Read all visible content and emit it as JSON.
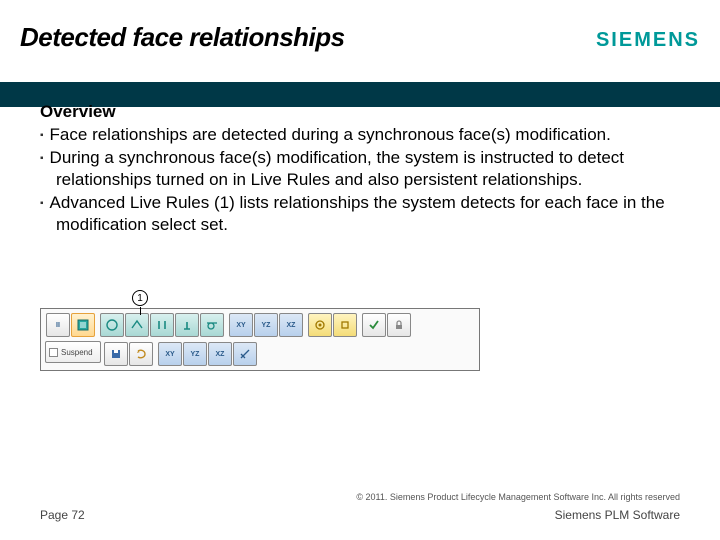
{
  "header": {
    "title": "Detected face relationships",
    "logo": "SIEMENS"
  },
  "content": {
    "overview_label": "Overview",
    "bullets": [
      "Face relationships are detected during a synchronous face(s) modification.",
      "During a synchronous face(s) modification, the system is instructed to detect relationships turned on in Live Rules and also persistent relationships.",
      "Advanced Live Rules (1) lists relationships the system detects for each face in the modification select set."
    ]
  },
  "toolbar": {
    "callout": "1",
    "suspend_label": "Suspend",
    "row1_icons": [
      "pause",
      "advanced",
      "symmetry",
      "coplanar",
      "parallel",
      "perp",
      "tangent",
      "xy",
      "yz",
      "xz",
      "concentric",
      "local",
      "solve",
      "lock"
    ],
    "row2_icons": [
      "save",
      "hand",
      "xy2",
      "yz2",
      "xz2",
      "diag"
    ]
  },
  "footer": {
    "copyright": "© 2011. Siemens Product Lifecycle Management Software Inc. All rights reserved",
    "page": "Page 72",
    "brand": "Siemens PLM Software"
  }
}
